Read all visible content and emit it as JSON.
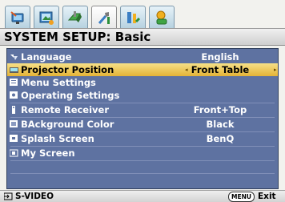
{
  "tabs": [
    {
      "name": "display-tab",
      "icon": "monitor-icon",
      "active": false
    },
    {
      "name": "picture-tab",
      "icon": "picture-icon",
      "active": false
    },
    {
      "name": "source-tab",
      "icon": "source-icon",
      "active": false
    },
    {
      "name": "system-setup-basic-tab",
      "icon": "tools-icon",
      "active": true
    },
    {
      "name": "system-setup-advanced-tab",
      "icon": "advanced-tools-icon",
      "active": false
    },
    {
      "name": "information-tab",
      "icon": "information-icon",
      "active": false
    }
  ],
  "title": "SYSTEM SETUP: Basic",
  "menu": {
    "items": [
      {
        "label": "Language",
        "value": "English",
        "icon": "language-icon",
        "selected": false
      },
      {
        "label": "Projector Position",
        "value": "Front Table",
        "icon": "projector-icon",
        "selected": true
      },
      {
        "label": "Menu Settings",
        "value": "",
        "icon": "menu-settings-icon",
        "selected": false
      },
      {
        "label": "Operating Settings",
        "value": "",
        "icon": "operating-settings-icon",
        "selected": false
      },
      {
        "label": "Remote Receiver",
        "value": "Front+Top",
        "icon": "remote-receiver-icon",
        "selected": false
      },
      {
        "label": "BAckground Color",
        "value": "Black",
        "icon": "background-color-icon",
        "selected": false
      },
      {
        "label": "Splash Screen",
        "value": "BenQ",
        "icon": "splash-screen-icon",
        "selected": false
      },
      {
        "label": "My Screen",
        "value": "",
        "icon": "my-screen-icon",
        "selected": false
      }
    ],
    "left_arrow": "◂",
    "right_arrow": "▸"
  },
  "footer": {
    "source": "S-VIDEO",
    "source_icon": "input-source-icon",
    "menu_button": "MENU",
    "exit": "Exit"
  },
  "colors": {
    "panel": "#5e72a1",
    "highlight": "#e9bd45",
    "tab": "#c8dfeb"
  }
}
